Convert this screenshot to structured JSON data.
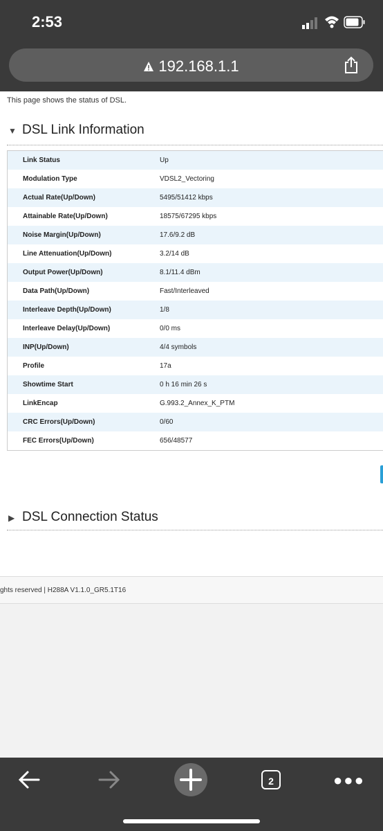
{
  "status_bar": {
    "time": "2:53"
  },
  "browser": {
    "url": "192.168.1.1",
    "open_tabs": "2"
  },
  "page": {
    "intro": "This page shows the status of DSL.",
    "link_info_title": "DSL Link Information",
    "connection_status_title": "DSL Connection Status",
    "rows": [
      {
        "label": "Link Status",
        "value": "Up"
      },
      {
        "label": "Modulation Type",
        "value": "VDSL2_Vectoring"
      },
      {
        "label": "Actual Rate(Up/Down)",
        "value": "5495/51412 kbps"
      },
      {
        "label": "Attainable Rate(Up/Down)",
        "value": "18575/67295 kbps"
      },
      {
        "label": "Noise Margin(Up/Down)",
        "value": "17.6/9.2 dB"
      },
      {
        "label": "Line Attenuation(Up/Down)",
        "value": "3.2/14 dB"
      },
      {
        "label": "Output Power(Up/Down)",
        "value": "8.1/11.4 dBm"
      },
      {
        "label": "Data Path(Up/Down)",
        "value": "Fast/Interleaved"
      },
      {
        "label": "Interleave Depth(Up/Down)",
        "value": "1/8"
      },
      {
        "label": "Interleave Delay(Up/Down)",
        "value": "0/0 ms"
      },
      {
        "label": "INP(Up/Down)",
        "value": "4/4 symbols"
      },
      {
        "label": "Profile",
        "value": "17a"
      },
      {
        "label": "Showtime Start",
        "value": "0 h 16 min 26 s"
      },
      {
        "label": "LinkEncap",
        "value": "G.993.2_Annex_K_PTM"
      },
      {
        "label": "CRC Errors(Up/Down)",
        "value": "0/60"
      },
      {
        "label": "FEC Errors(Up/Down)",
        "value": "656/48577"
      }
    ],
    "footer": "ghts reserved  |   H288A V1.1.0_GR5.1T16"
  },
  "icons": {
    "expanded": "triangle-down-icon",
    "collapsed": "triangle-right-icon",
    "warning": "warning-icon",
    "share": "share-icon"
  }
}
